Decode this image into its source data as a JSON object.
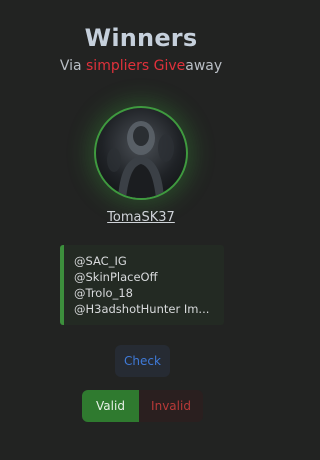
{
  "header": {
    "title": "Winners",
    "subtitle_prefix": "Via ",
    "subtitle_brand": "simpliers",
    "subtitle_mid": " Give",
    "subtitle_suffix": "away"
  },
  "winner": {
    "name": "TomaSK37"
  },
  "mentions": [
    "@SAC_IG",
    "@SkinPlaceOff",
    "@Trolo_18",
    "@H3adshotHunter Im..."
  ],
  "actions": {
    "check_label": "Check",
    "valid_label": "Valid",
    "invalid_label": "Invalid"
  },
  "colors": {
    "accent_green": "#3c8f3c",
    "brand_red": "#e0313b",
    "check_blue": "#3f7ad8"
  }
}
